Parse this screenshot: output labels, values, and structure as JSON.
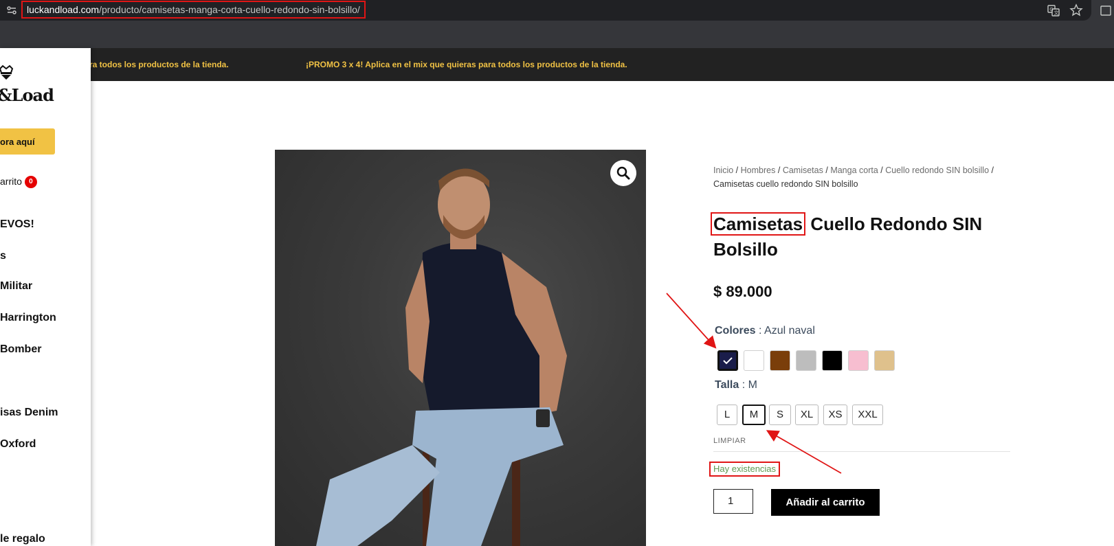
{
  "browser": {
    "url_domain": "luckandload.com",
    "url_path": "/producto/camisetas-manga-corta-cuello-redondo-sin-bolsillo/",
    "icons": [
      "site-settings-icon",
      "translate-icon",
      "bookmark-star-icon",
      "extension-icon"
    ]
  },
  "promo": {
    "text_partial": "ra todos los productos de la tienda.",
    "text": "¡PROMO 3 x 4! Aplica en el mix que quieras para todos los productos de la tienda."
  },
  "sidebar": {
    "logo_text": "&Load",
    "cta_label": "ora aquí",
    "cart_label": "arrito",
    "cart_count": "0",
    "items": [
      "EVOS!",
      "s",
      "Militar",
      "Harrington",
      "Bomber",
      "isas Denim",
      "Oxford",
      "le regalo"
    ]
  },
  "breadcrumb": {
    "links": [
      "Inicio",
      "Hombres",
      "Camisetas",
      "Manga corta",
      "Cuello redondo SIN bolsillo"
    ],
    "separator": "/",
    "current": "Camisetas cuello redondo SIN bolsillo"
  },
  "product": {
    "title_highlight": "Camisetas",
    "title_rest": "Cuello Redondo SIN Bolsillo",
    "price": "$ 89.000",
    "colors_label": "Colores",
    "colors_separator": ":",
    "selected_color": "Azul naval",
    "swatches": [
      "#1a1d4a",
      "#ffffff",
      "#7a3e0a",
      "#bdbdbd",
      "#000000",
      "#f7bed0",
      "#dfc18c"
    ],
    "size_label": "Talla",
    "size_separator": ":",
    "selected_size": "M",
    "sizes": [
      "L",
      "M",
      "S",
      "XL",
      "XS",
      "XXL"
    ],
    "clear_label": "LIMPIAR",
    "stock_text": "Hay existencias",
    "quantity": "1",
    "add_to_cart_label": "Añadir al carrito"
  },
  "colors": {
    "promo_text": "#f1c244",
    "annotation_red": "#e01515",
    "stock_green": "#5f9a51",
    "cart_badge": "#e50000"
  }
}
